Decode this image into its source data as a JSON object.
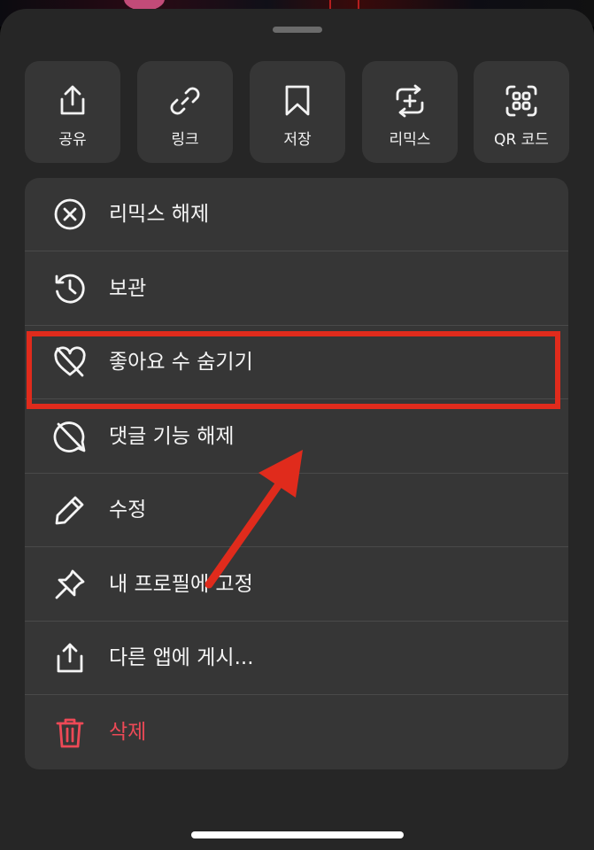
{
  "share_tiles": [
    {
      "label": "공유",
      "icon": "share-icon"
    },
    {
      "label": "링크",
      "icon": "link-icon"
    },
    {
      "label": "저장",
      "icon": "bookmark-icon"
    },
    {
      "label": "리믹스",
      "icon": "remix-icon"
    },
    {
      "label": "QR 코드",
      "icon": "qr-code-icon"
    }
  ],
  "menu_items": [
    {
      "label": "리믹스 해제",
      "icon": "x-circle-icon"
    },
    {
      "label": "보관",
      "icon": "archive-history-icon"
    },
    {
      "label": "좋아요 수 숨기기",
      "icon": "heart-slash-icon"
    },
    {
      "label": "댓글 기능 해제",
      "icon": "comment-slash-icon"
    },
    {
      "label": "수정",
      "icon": "pencil-icon"
    },
    {
      "label": "내 프로필에 고정",
      "icon": "pin-icon"
    },
    {
      "label": "다른 앱에 게시...",
      "icon": "share-icon"
    },
    {
      "label": "삭제",
      "icon": "trash-icon"
    }
  ],
  "colors": {
    "sheet_bg": "#262626",
    "card_bg": "#363636",
    "text": "#f5f5f5",
    "danger": "#ed4956",
    "annotation": "#e02b1c"
  }
}
